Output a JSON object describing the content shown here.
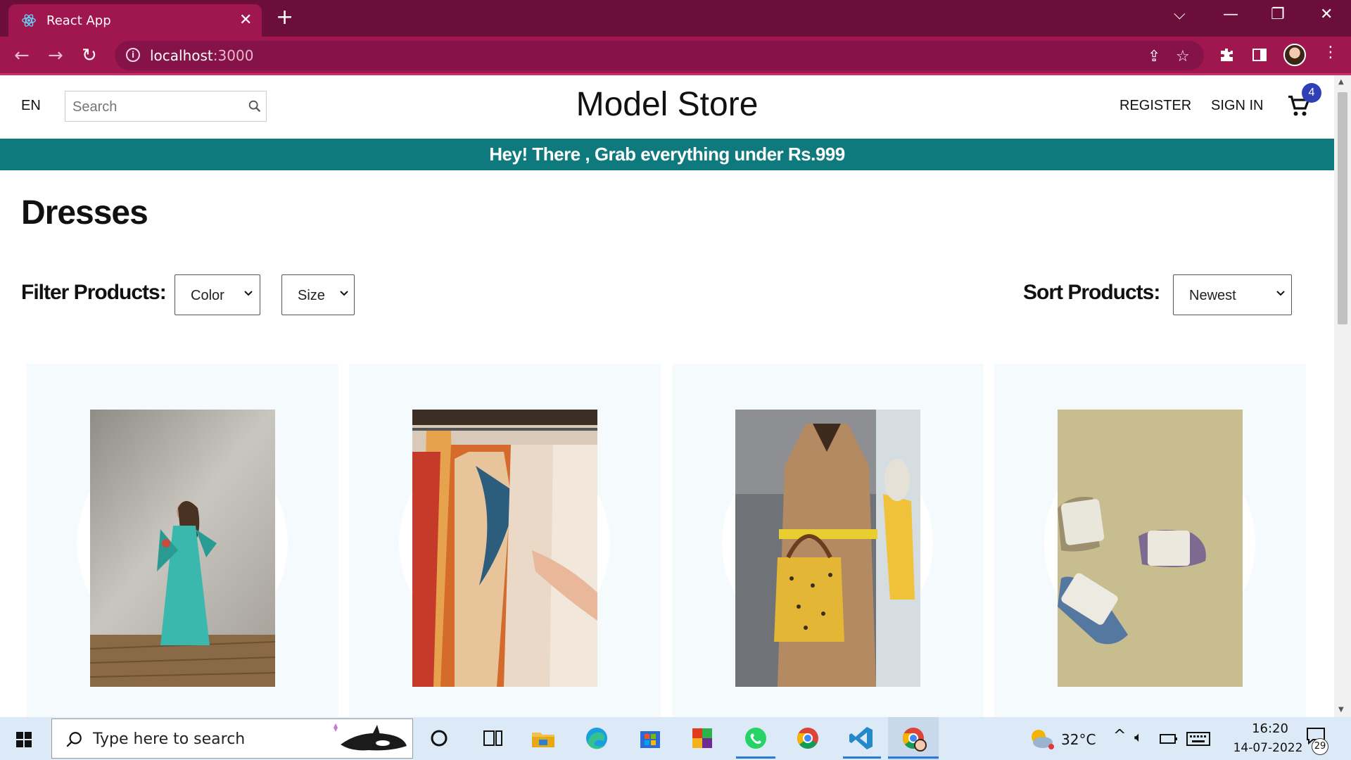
{
  "browser": {
    "tab_title": "React App",
    "url_host": "localhost",
    "url_port": ":3000"
  },
  "header": {
    "lang": "EN",
    "search_placeholder": "Search",
    "brand": "Model Store",
    "register": "REGISTER",
    "sign_in": "SIGN IN",
    "cart_count": "4"
  },
  "announcement": "Hey! There , Grab everything under Rs.999",
  "page_title": "Dresses",
  "filters": {
    "label": "Filter Products:",
    "color": "Color",
    "size": "Size"
  },
  "sort": {
    "label": "Sort Products:",
    "selected": "Newest"
  },
  "products": [
    {
      "image": "woman-in-teal-saree"
    },
    {
      "image": "colorful-dresses-on-rack"
    },
    {
      "image": "trench-coat-with-yellow-bag"
    },
    {
      "image": "rolled-socks-on-beige"
    }
  ],
  "taskbar": {
    "search_placeholder": "Type here to search",
    "temperature": "32°C",
    "time": "16:20",
    "date": "14-07-2022",
    "notifications": "29"
  },
  "colors": {
    "tab_bar": "#6b0f3a",
    "toolbar": "#a0174f",
    "announcement": "#0f7a7e",
    "cart_badge": "#2f3fb5"
  }
}
